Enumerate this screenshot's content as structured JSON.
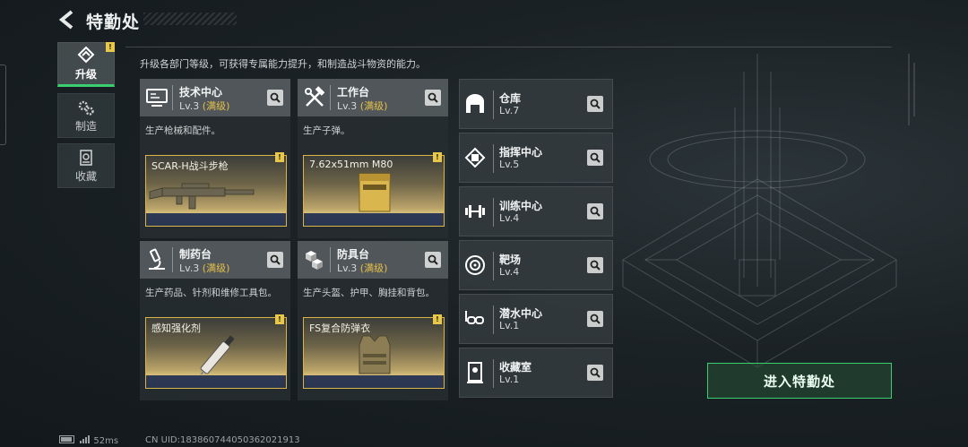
{
  "header": {
    "title": "特勤处"
  },
  "side_tabs": [
    {
      "label": "升级",
      "icon": "upgrade-icon",
      "active": true,
      "badge": "!"
    },
    {
      "label": "制造",
      "icon": "gears-icon",
      "active": false
    },
    {
      "label": "收藏",
      "icon": "collection-icon",
      "active": false
    }
  ],
  "description": "升级各部门等级，可获得专属能力提升，和制造战斗物资的能力。",
  "workshops": [
    {
      "name": "技术中心",
      "level": "Lv.3",
      "max": "(满级)",
      "desc": "生产枪械和配件。",
      "product": "SCAR-H战斗步枪",
      "badge": "!"
    },
    {
      "name": "工作台",
      "level": "Lv.3",
      "max": "(满级)",
      "desc": "生产子弹。",
      "product": "7.62x51mm M80",
      "badge": "!"
    },
    {
      "name": "制药台",
      "level": "Lv.3",
      "max": "(满级)",
      "desc": "生产药品、针剂和维修工具包。",
      "product": "感知强化剂",
      "badge": "!"
    },
    {
      "name": "防具台",
      "level": "Lv.3",
      "max": "(满级)",
      "desc": "生产头盔、护甲、胸挂和背包。",
      "product": "FS复合防弹衣",
      "badge": "!"
    }
  ],
  "facilities": [
    {
      "name": "仓库",
      "level": "Lv.7",
      "icon": "warehouse-icon"
    },
    {
      "name": "指挥中心",
      "level": "Lv.5",
      "icon": "chip-icon"
    },
    {
      "name": "训练中心",
      "level": "Lv.4",
      "icon": "dumbbell-icon"
    },
    {
      "name": "靶场",
      "level": "Lv.4",
      "icon": "target-icon"
    },
    {
      "name": "潜水中心",
      "level": "Lv.1",
      "icon": "diving-mask-icon"
    },
    {
      "name": "收藏室",
      "level": "Lv.1",
      "icon": "collection-room-icon"
    }
  ],
  "enter_button": "进入特勤处",
  "status_bar": {
    "ping": "52ms",
    "uid": "CN UID:1838607440503620219​13"
  },
  "colors": {
    "accent_green": "#3ccf70",
    "gold": "#e5c04a"
  }
}
